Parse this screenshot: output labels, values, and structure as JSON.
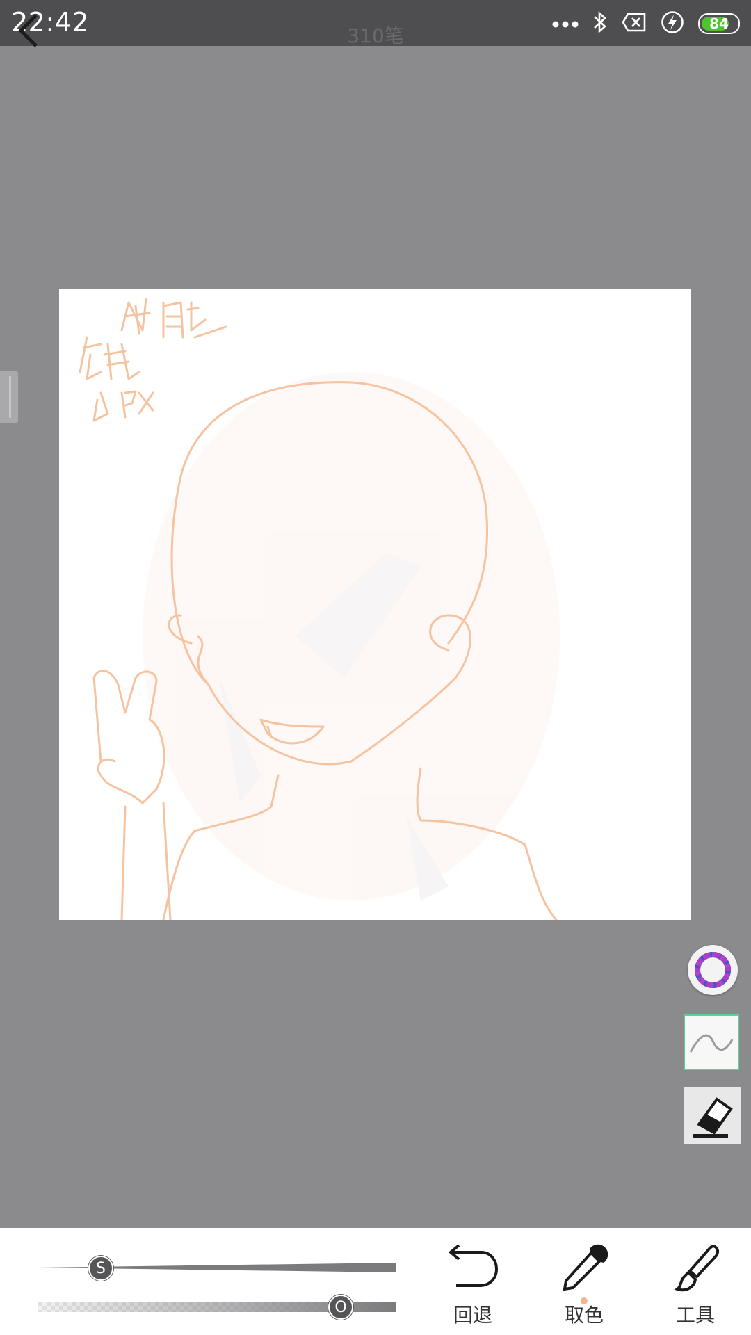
{
  "status_bar": {
    "time": "22:42",
    "battery": "84",
    "battery_level": 0.84,
    "icons": [
      "more-dots-icon",
      "bluetooth-icon",
      "data-off-icon",
      "charging-icon",
      "battery-icon"
    ]
  },
  "header": {
    "back_icon": "back-arrow-icon",
    "stroke_count": "310笔"
  },
  "canvas": {
    "sketch_color": "#f5c39f",
    "handwritten_note": [
      "纸膜",
      "铅笔",
      "6Px"
    ]
  },
  "side_tools": {
    "color_picker": "color-wheel-icon",
    "brush_preview": "pen-stroke-icon",
    "eraser": "eraser-icon",
    "selected": "brush_preview"
  },
  "sliders": {
    "size": {
      "label": "S",
      "value": 0.15
    },
    "opacity": {
      "label": "O",
      "value": 0.87
    }
  },
  "toolbar": {
    "undo_label": "回退",
    "eyedropper_label": "取色",
    "tools_label": "工具"
  },
  "colors": {
    "background": "#8b8a8d",
    "status_bar": "#4e4e50",
    "accent_selected": "#5fd09c",
    "battery_green": "#4fc22f"
  }
}
